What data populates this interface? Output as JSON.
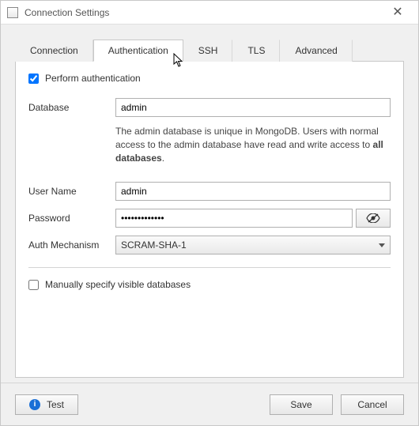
{
  "window": {
    "title": "Connection Settings",
    "close_tooltip": "Close"
  },
  "tabs": {
    "connection": "Connection",
    "authentication": "Authentication",
    "ssh": "SSH",
    "tls": "TLS",
    "advanced": "Advanced",
    "active": "authentication"
  },
  "auth": {
    "perform_label": "Perform authentication",
    "perform_checked": true,
    "database_label": "Database",
    "database_value": "admin",
    "database_hint_pre": "The admin database is unique in MongoDB. Users with normal access to the admin database have read and write access to ",
    "database_hint_bold": "all databases",
    "database_hint_post": ".",
    "username_label": "User Name",
    "username_value": "admin",
    "password_label": "Password",
    "password_value": "•••••••••••••",
    "mechanism_label": "Auth Mechanism",
    "mechanism_value": "SCRAM-SHA-1",
    "manual_db_label": "Manually specify visible databases",
    "manual_db_checked": false
  },
  "footer": {
    "test": "Test",
    "save": "Save",
    "cancel": "Cancel"
  }
}
